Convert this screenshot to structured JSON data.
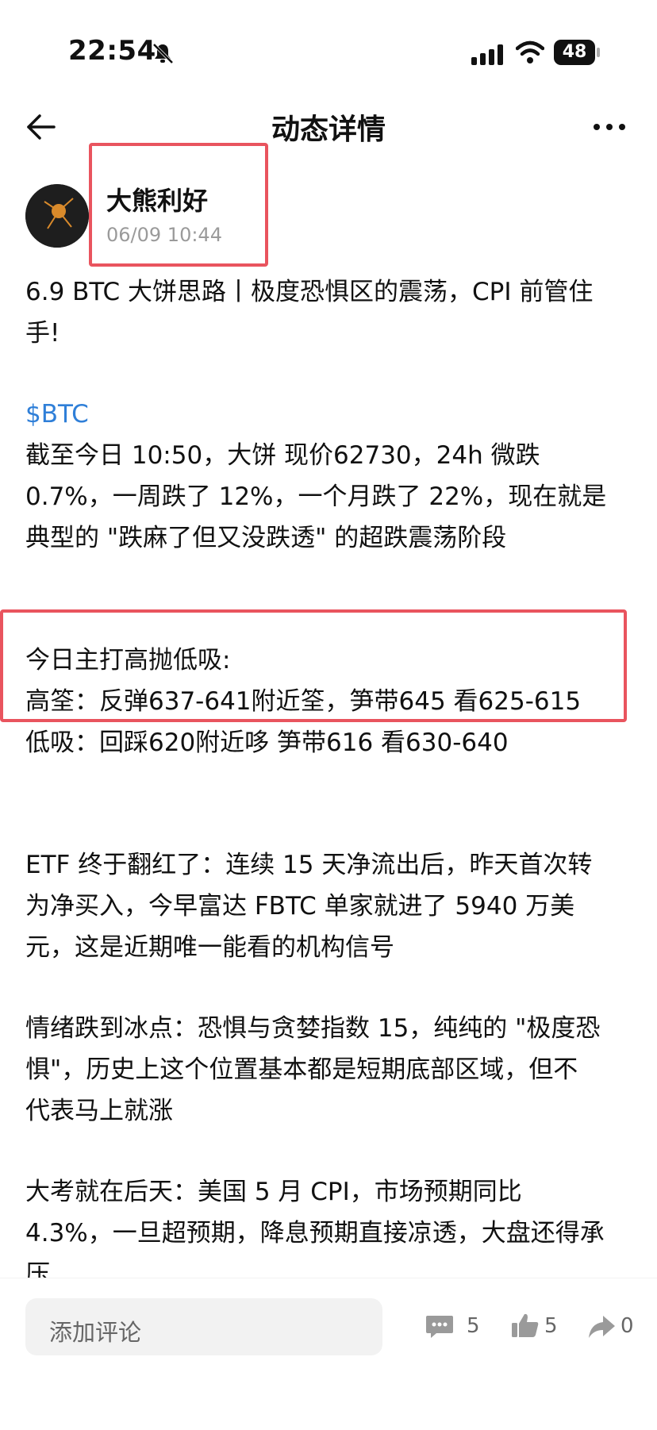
{
  "status_bar": {
    "time": "22:54",
    "battery": "48"
  },
  "header": {
    "title": "动态详情"
  },
  "author": {
    "name": "大熊利好",
    "timestamp": "06/09 10:44"
  },
  "post": {
    "title_line1": "6.9 BTC 大饼思路丨极度恐惧区的震荡，CPI 前管住",
    "title_line2": "手!",
    "tag": "$BTC",
    "p1_line1": "截至今日 10:50，大饼 现价62730，24h 微跌",
    "p1_line2": "0.7%，一周跌了 12%，一个月跌了 22%，现在就是",
    "p1_line3": "典型的 \"跌麻了但又没跌透\" 的超跌震荡阶段",
    "plan_title": "今日主打高抛低吸:",
    "plan_short": "高筌：反弹637-641附近筌，笋带645  看625-615",
    "plan_long": "低吸：回踩620附近哆  笋带616  看630-640",
    "p2_line1": "ETF 终于翻红了：连续 15 天净流出后，昨天首次转",
    "p2_line2": "为净买入，今早富达 FBTC 单家就进了 5940 万美",
    "p2_line3": "元，这是近期唯一能看的机构信号",
    "p3_line1": "情绪跌到冰点：恐惧与贪婪指数 15，纯纯的 \"极度恐",
    "p3_line2": "惧\"，历史上这个位置基本都是短期底部区域，但不",
    "p3_line3": "代表马上就涨",
    "p4_line1": "大考就在后天：美国 5 月 CPI，市场预期同比",
    "p4_line2": "4.3%，一旦超预期，降息预期直接凉透，大盘还得承",
    "p4_line3": "压"
  },
  "bottom_bar": {
    "comment_placeholder": "添加评论",
    "comments_count": "5",
    "likes_count": "5",
    "shares_count": "0"
  },
  "colors": {
    "highlight_box": "#e9545e",
    "tag": "#2f7fd8"
  }
}
